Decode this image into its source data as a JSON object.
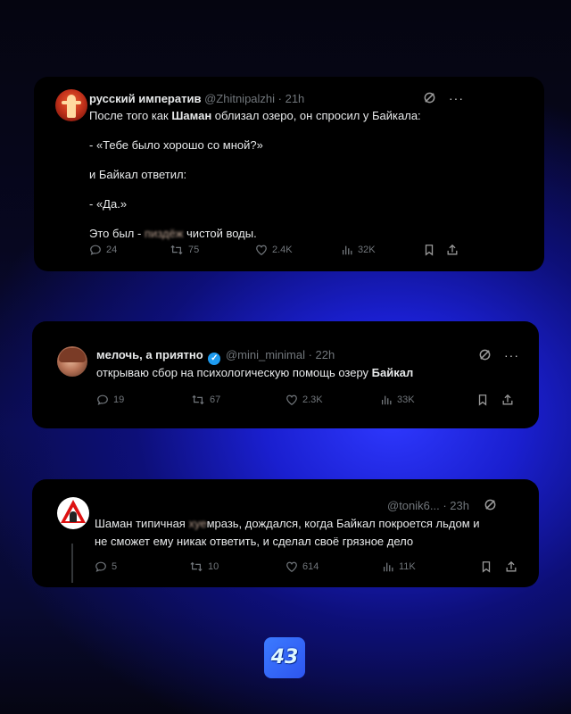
{
  "tweets": [
    {
      "name": "русский императив",
      "handle": "@Zhitnipalzhi",
      "time": "· 21h",
      "lines": {
        "l1_pre": "После того как ",
        "l1_bold": "Шаман",
        "l1_post": " облизал озеро, он спросил у Байкала:",
        "l2": "- «Тебе было хорошо со мной?»",
        "l3": "и Байкал ответил:",
        "l4": "- «Да.»",
        "l5_pre": "Это был - ",
        "l5_blur": "пиздёж",
        "l5_post": " чистой воды."
      },
      "stats": {
        "replies": "24",
        "retweets": "75",
        "likes": "2.4K",
        "views": "32K"
      }
    },
    {
      "name": "мелочь, а приятно",
      "verified": "✓",
      "handle": "@mini_minimal",
      "time": "· 22h",
      "text_pre": "открываю сбор на психологическую помощь озеру ",
      "text_bold": "Байкал",
      "stats": {
        "replies": "19",
        "retweets": "67",
        "likes": "2.3K",
        "views": "33K"
      }
    },
    {
      "handle": "@tonik6...",
      "time": "· 23h",
      "line1_pre": "Шаман типичная ",
      "line1_blur": "хуе",
      "line1_post": "мразь, дождался, когда Байкал покроется льдом и",
      "line2": "не сможет ему никак ответить, и сделал своё грязное дело",
      "stats": {
        "replies": "5",
        "retweets": "10",
        "likes": "614",
        "views": "11K"
      }
    }
  ],
  "icons": {
    "reply": "reply-icon",
    "retweet": "retweet-icon",
    "like": "heart-icon",
    "views": "views-icon",
    "bookmark": "bookmark-icon",
    "share": "share-icon",
    "grok": "grok-icon",
    "more": "more-icon"
  },
  "more_dots": "···",
  "page_badge": "43",
  "colors": {
    "card_bg": "#000000",
    "muted": "#71767b",
    "text": "#e7e9ea",
    "verified": "#1d9bf0",
    "badge": "#3c7bff"
  }
}
